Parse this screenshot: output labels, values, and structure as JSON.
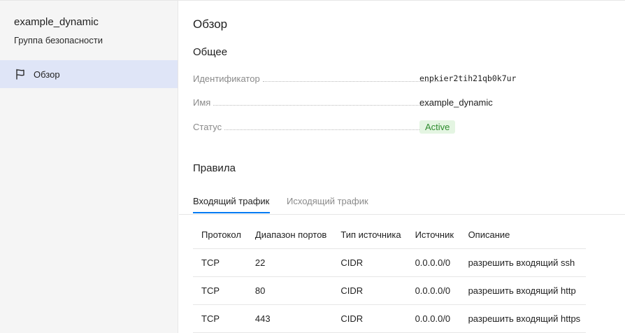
{
  "sidebar": {
    "title": "example_dynamic",
    "subtitle": "Группа безопасности",
    "items": [
      {
        "label": "Обзор",
        "icon": "flag-icon"
      }
    ]
  },
  "main": {
    "title": "Обзор",
    "general": {
      "heading": "Общее",
      "properties": [
        {
          "key": "Идентификатор",
          "value": "enpkier2tih21qb0k7ur"
        },
        {
          "key": "Имя",
          "value": "example_dynamic"
        },
        {
          "key": "Статус",
          "value": "Active"
        }
      ]
    },
    "rules": {
      "heading": "Правила",
      "tabs": [
        {
          "label": "Входящий трафик",
          "active": true
        },
        {
          "label": "Исходящий трафик",
          "active": false
        }
      ],
      "columns": [
        "Протокол",
        "Диапазон портов",
        "Тип источника",
        "Источник",
        "Описание"
      ],
      "rows": [
        [
          "TCP",
          "22",
          "CIDR",
          "0.0.0.0/0",
          "разрешить входящий ssh"
        ],
        [
          "TCP",
          "80",
          "CIDR",
          "0.0.0.0/0",
          "разрешить входящий http"
        ],
        [
          "TCP",
          "443",
          "CIDR",
          "0.0.0.0/0",
          "разрешить входящий https"
        ]
      ]
    }
  },
  "colors": {
    "accent": "#027bf3",
    "sidebar_bg": "#f5f5f5",
    "sidebar_selected": "#dfe5f7",
    "status_bg": "#e4f5e2",
    "status_text": "#2f8c2f"
  }
}
